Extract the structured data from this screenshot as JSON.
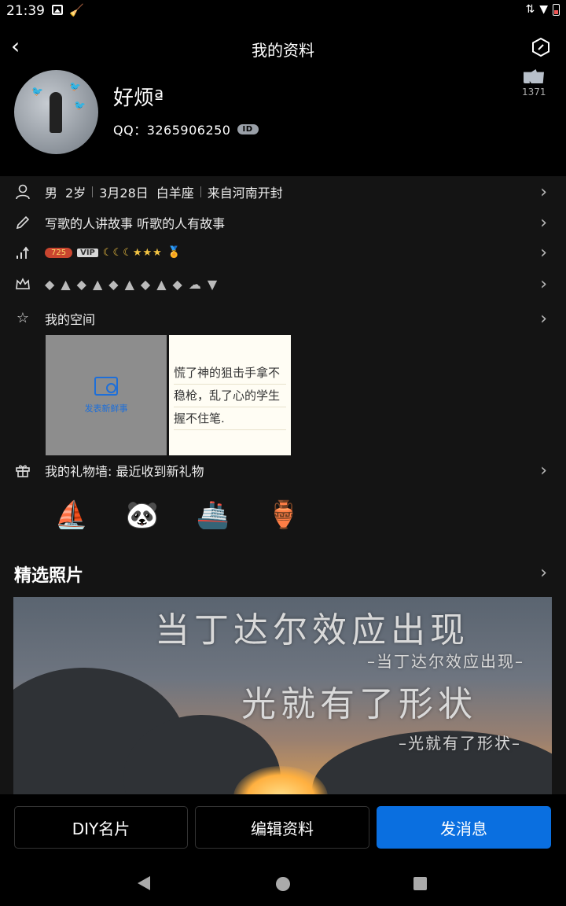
{
  "status_bar": {
    "time": "21:39"
  },
  "header": {
    "title": "我的资料"
  },
  "profile": {
    "nickname": "好烦ª",
    "qq_label": "QQ：3265906250",
    "id_badge": "ID",
    "like_count": "1371"
  },
  "info_rows": {
    "gender": "男",
    "age": "2岁",
    "birthday": "3月28日",
    "zodiac": "白羊座",
    "hometown": "来自河南开封",
    "signature": "写歌的人讲故事  听歌的人有故事",
    "coin_value": "725",
    "vip_label": "VIP",
    "level_marks": "☾☾☾★★★"
  },
  "space": {
    "title": "我的空间",
    "post_label": "发表新鲜事",
    "note_lines": [
      "慌了神的狙击手拿不",
      "稳枪，乱了心的学生",
      "握不住笔."
    ]
  },
  "gifts": {
    "title": "我的礼物墙: 最近收到新礼物"
  },
  "photos": {
    "title": "精选照片",
    "line1": "当丁达尔效应出现",
    "line2": "–当丁达尔效应出现–",
    "line3": "光就有了形状",
    "line4": "–光就有了形状–"
  },
  "actions": {
    "diy": "DIY名片",
    "edit": "编辑资料",
    "message": "发消息"
  },
  "colors": {
    "primary": "#0a6fe0",
    "background": "#000000",
    "panel": "#141414"
  }
}
